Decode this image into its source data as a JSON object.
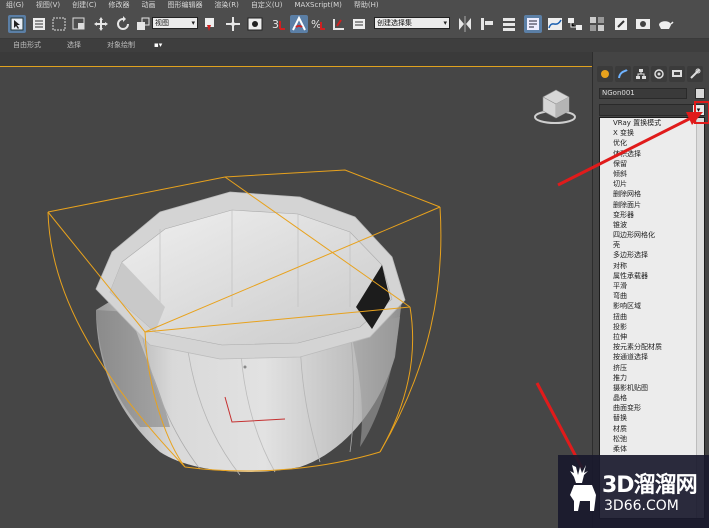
{
  "menubar": {
    "items": [
      "组(G)",
      "视图(V)",
      "创建(C)",
      "修改器",
      "动画",
      "图形编辑器",
      "渲染(R)",
      "自定义(U)",
      "MAXScript(M)",
      "帮助(H)"
    ]
  },
  "toolbar": {
    "selection_filter": "视图",
    "named_selection_set": "创建选择集"
  },
  "ribbon": {
    "tabs": [
      "自由形式",
      "选择",
      "对象绘制"
    ]
  },
  "command_panel": {
    "object_name": "NGon001",
    "object_color": "#d8d8d8",
    "modifier_list": [
      "VRay 置换模式",
      "X 变换",
      "优化",
      "体积选择",
      "保留",
      "倾斜",
      "切片",
      "删除网格",
      "删除面片",
      "变形器",
      "锥波",
      "四边形网格化",
      "壳",
      "多边形选择",
      "对称",
      "属性承载器",
      "平滑",
      "弯曲",
      "影响区域",
      "扭曲",
      "投影",
      "拉伸",
      "按元素分配材质",
      "按通道选择",
      "挤压",
      "推力",
      "摄影机贴图",
      "晶格",
      "曲面变形",
      "替换",
      "材质",
      "松弛",
      "柔体"
    ]
  },
  "watermark": {
    "line1": "3D溜溜网",
    "line2": "3D66.COM"
  },
  "colors": {
    "selection_box": "#e8a21d",
    "annotation_arrow": "#e01b1b",
    "highlight_tool": "#5b7fa6",
    "viewport_bg": "#464646"
  }
}
